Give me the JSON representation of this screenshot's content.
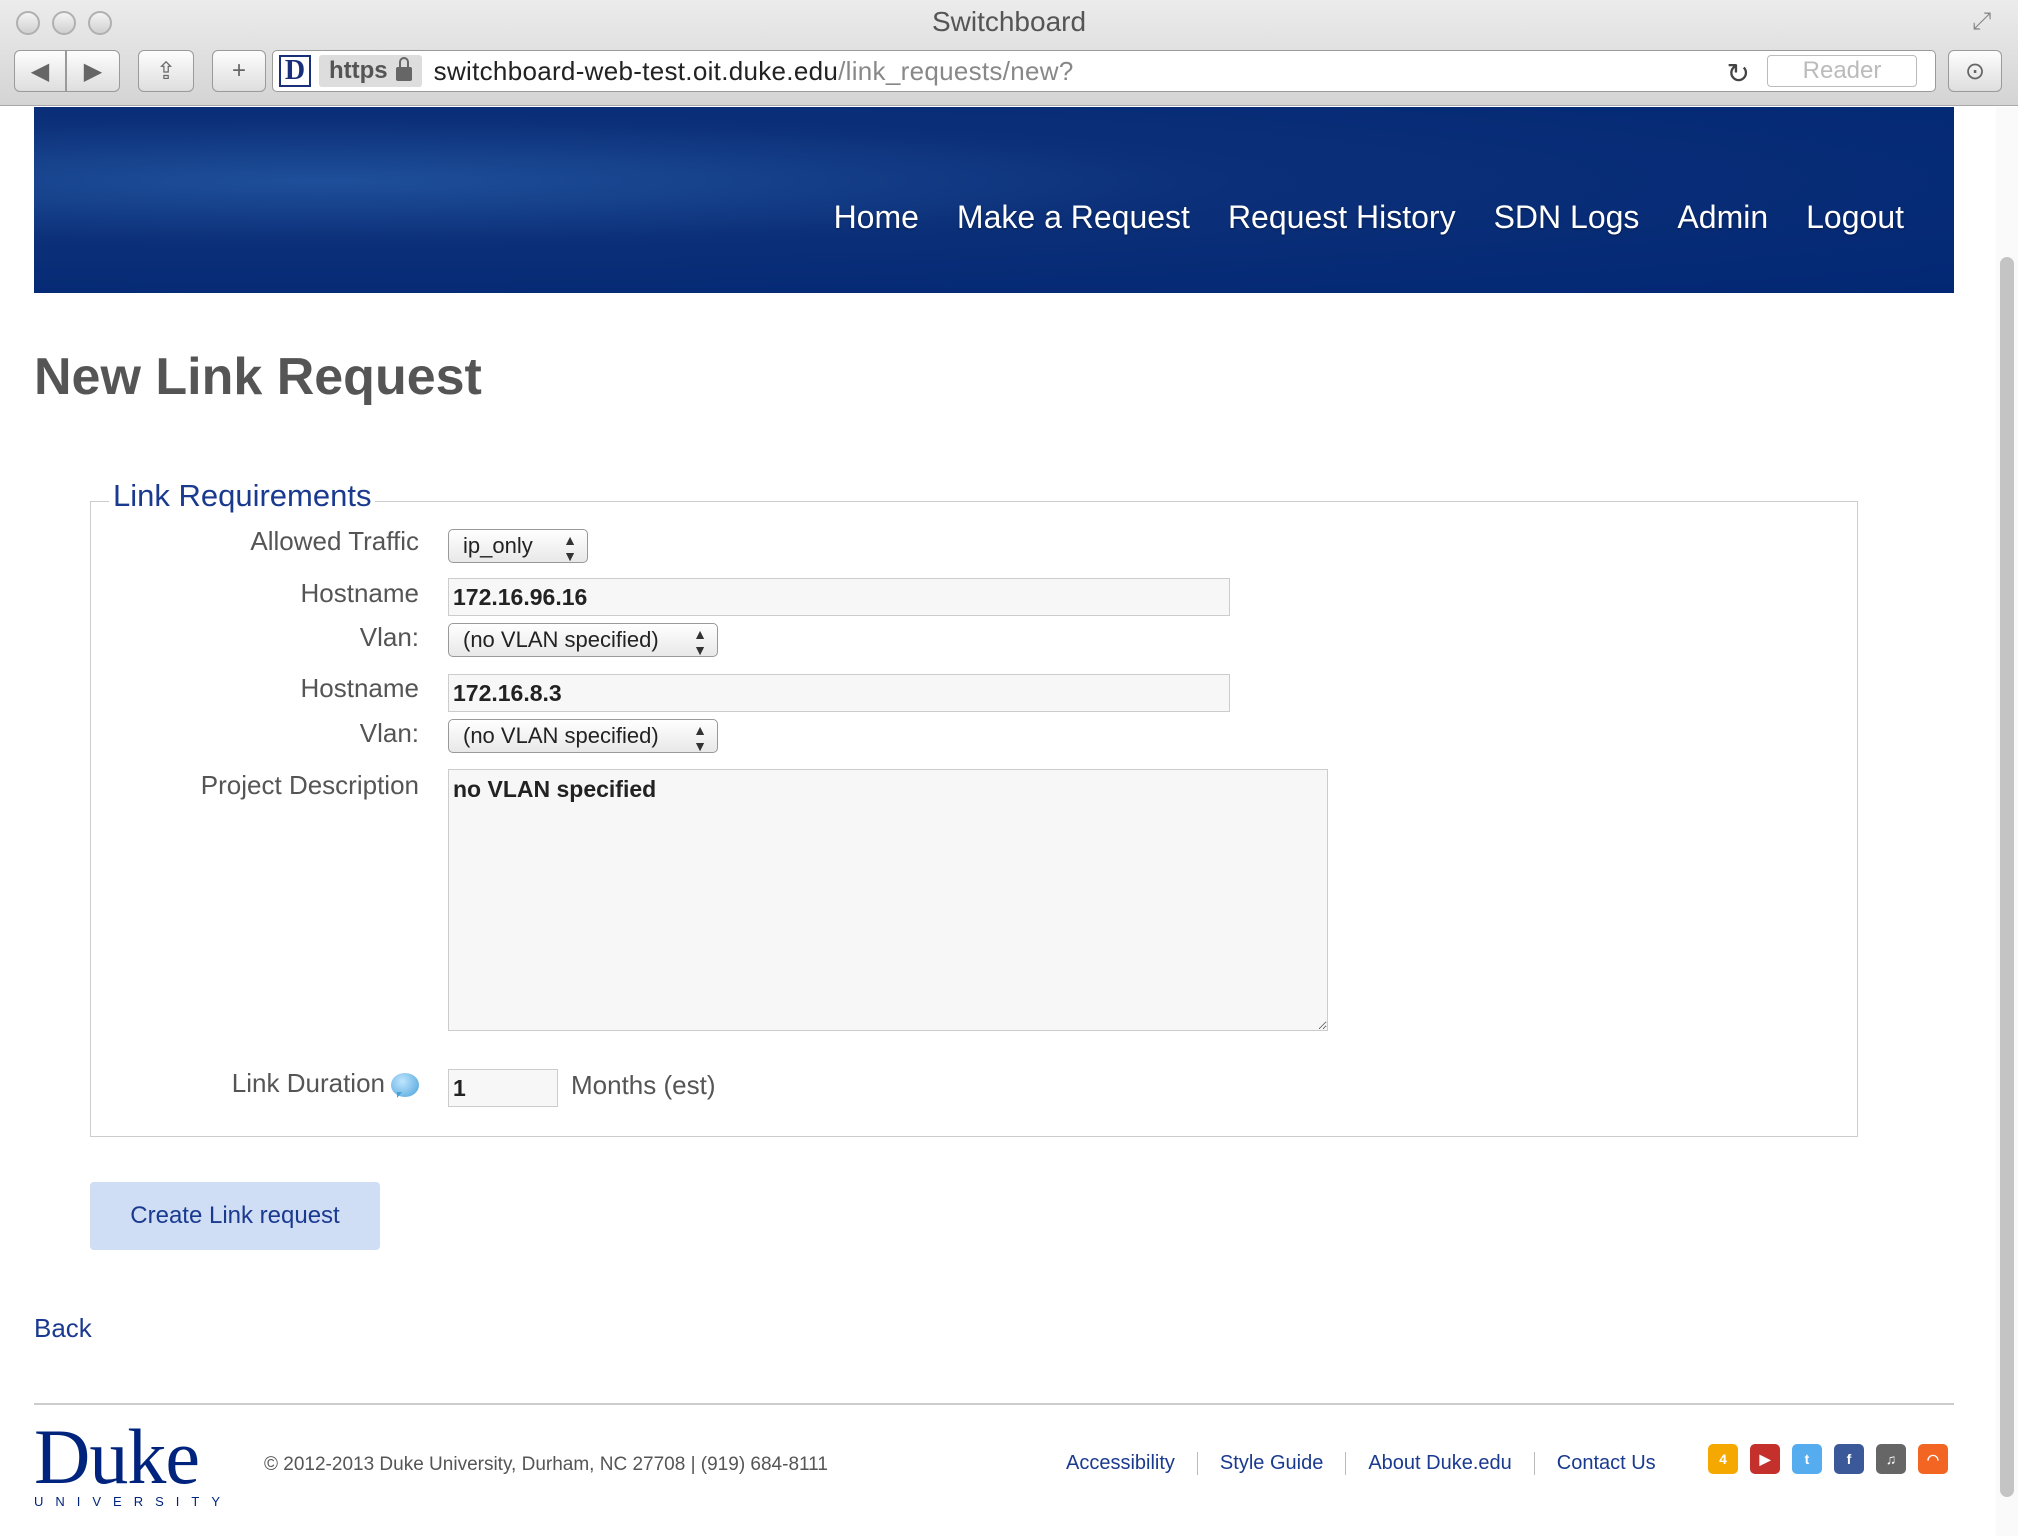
{
  "window": {
    "title": "Switchboard"
  },
  "toolbar": {
    "back_glyph": "◀",
    "forward_glyph": "▶",
    "share_glyph": "⇪",
    "add_tab_glyph": "+",
    "site_icon_letter": "D",
    "https_label": "https",
    "url_host": "switchboard-web-test.oit.duke.edu",
    "url_path": "/link_requests/new?",
    "reader_label": "Reader"
  },
  "nav": {
    "items": [
      "Home",
      "Make a Request",
      "Request History",
      "SDN Logs",
      "Admin",
      "Logout"
    ]
  },
  "page": {
    "title": "New Link Request"
  },
  "form": {
    "legend": "Link Requirements",
    "allowed_traffic_label": "Allowed Traffic",
    "allowed_traffic_value": "ip_only",
    "hostname1_label": "Hostname",
    "hostname1_value": "172.16.96.16",
    "vlan1_label": "Vlan:",
    "vlan1_value": "(no VLAN specified)",
    "hostname2_label": "Hostname",
    "hostname2_value": "172.16.8.3",
    "vlan2_label": "Vlan:",
    "vlan2_value": "(no VLAN specified)",
    "description_label": "Project Description",
    "description_value": "no VLAN specified",
    "duration_label": "Link Duration",
    "duration_value": "1",
    "duration_unit": "Months (est)",
    "submit_label": "Create Link request"
  },
  "back_link": "Back",
  "footer": {
    "logo_word": "Duke",
    "logo_sub": "UNIVERSITY",
    "copyright": "© 2012-2013 Duke University, Durham, NC 27708 | (919) 684-8111",
    "links": [
      "Accessibility",
      "Style Guide",
      "About Duke.edu",
      "Contact Us"
    ],
    "social": [
      {
        "icon": "foursquare-icon",
        "color": "#f5a800"
      },
      {
        "icon": "youtube-icon",
        "color": "#c4302b"
      },
      {
        "icon": "twitter-icon",
        "color": "#55acee"
      },
      {
        "icon": "facebook-icon",
        "color": "#3b5998"
      },
      {
        "icon": "itunes-icon",
        "color": "#666666"
      },
      {
        "icon": "rss-icon",
        "color": "#f26522"
      }
    ]
  },
  "colors": {
    "banner": "#022774",
    "link": "#1a3a8f",
    "button_bg": "#cfddf5"
  }
}
